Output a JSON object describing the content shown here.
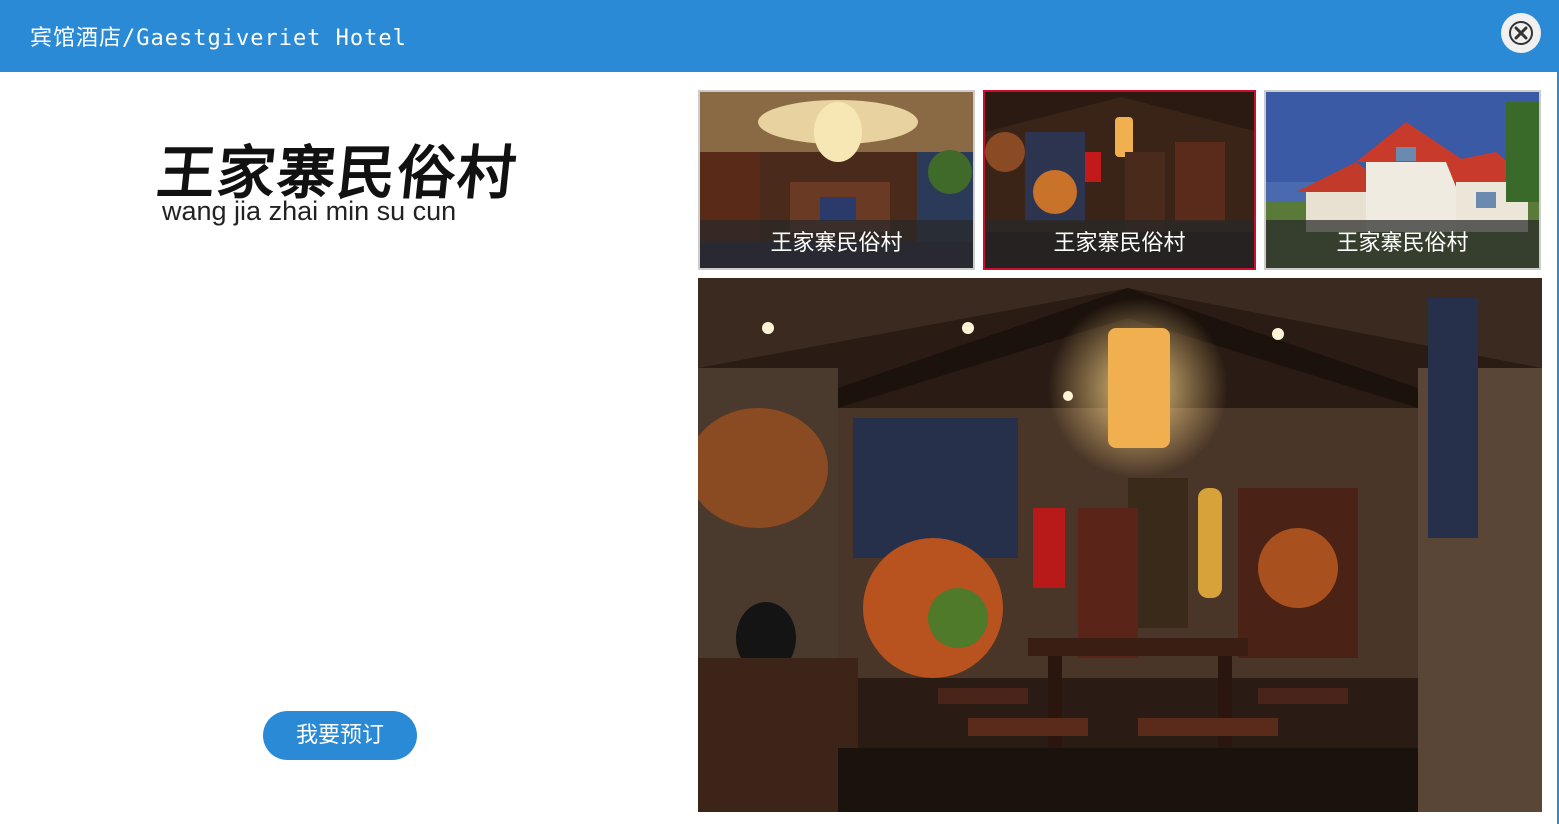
{
  "window": {
    "title": "宾馆酒店/Gaestgiveriet Hotel",
    "close_icon": "close-icon",
    "accent_color": "#2a8ad6"
  },
  "brand": {
    "name_cn": "王家寨民俗村",
    "name_pinyin": "wang jia zhai min su cun"
  },
  "booking": {
    "button_label": "我要预订"
  },
  "gallery": {
    "thumbnails": [
      {
        "caption": "王家寨民俗村",
        "scene": "banquet-hall",
        "selected": false
      },
      {
        "caption": "王家寨民俗村",
        "scene": "rustic-dining-room",
        "selected": true
      },
      {
        "caption": "王家寨民俗村",
        "scene": "villa-exterior",
        "selected": false
      }
    ],
    "selected_border_color": "#c8102e",
    "main_photo_scene": "rustic-dining-room"
  }
}
